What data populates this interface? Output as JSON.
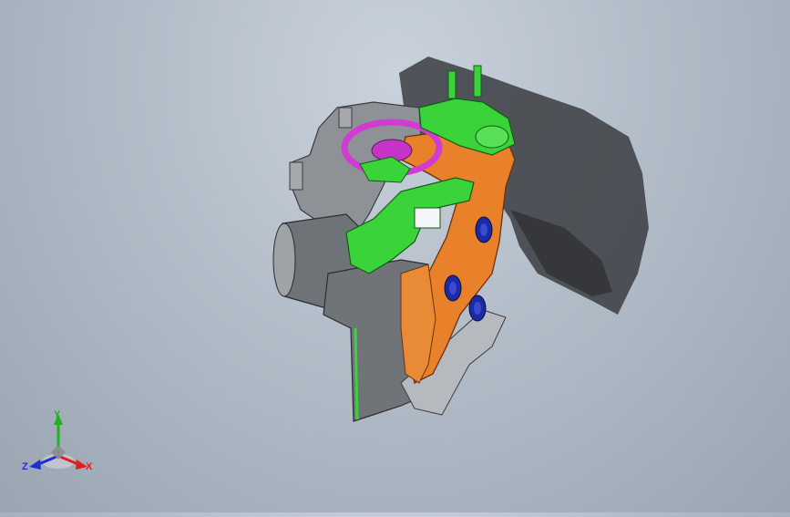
{
  "viewport": {
    "colors": {
      "background_top": "#c9d2dc",
      "background_bottom": "#9aa5b2",
      "housing_gray": "#8e9297",
      "orange_part": "#e8812a",
      "green_part": "#3ad43a",
      "magenta_part": "#d23bd2",
      "screw_blue": "#1c2aa6",
      "shadow": "#3b3d42"
    }
  },
  "triad": {
    "x_label": "X",
    "y_label": "Y",
    "z_label": "Z",
    "colors": {
      "x": "#e02020",
      "y": "#20b020",
      "z": "#2030d0"
    }
  }
}
